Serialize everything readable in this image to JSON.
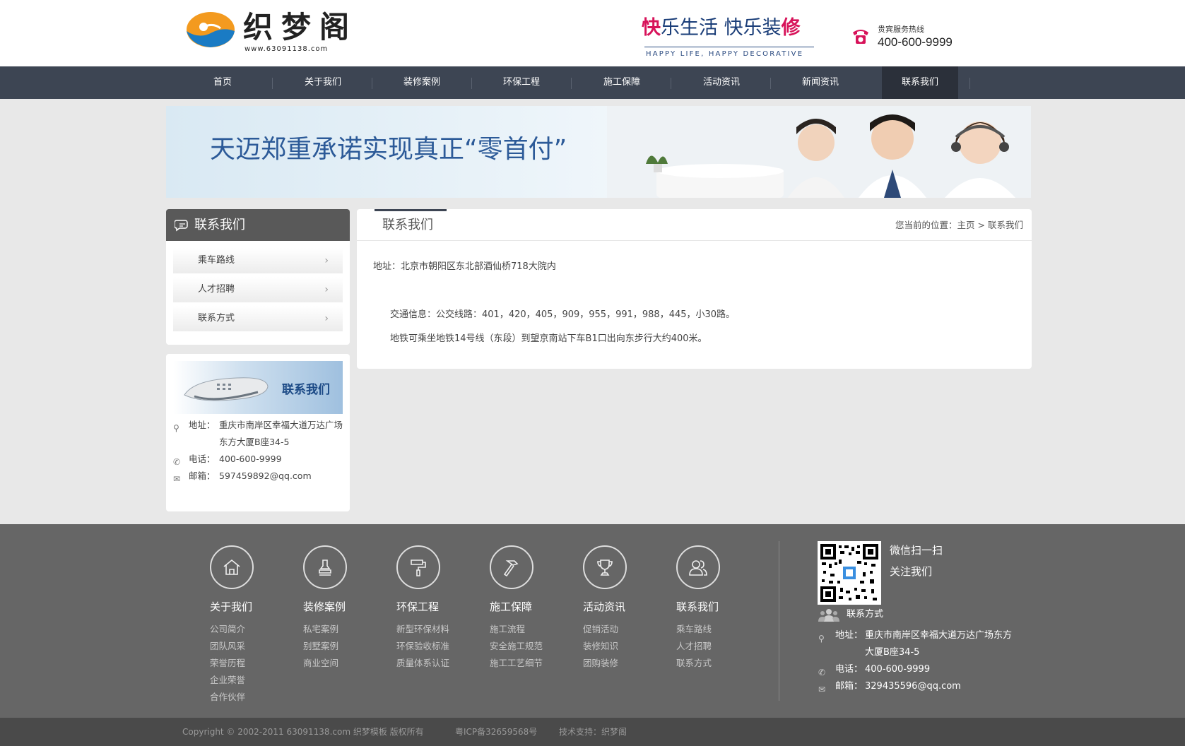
{
  "header": {
    "logo_text": "织梦阁",
    "logo_url": "www.63091138.com",
    "slogan_part1": "快",
    "slogan_part2": "乐生活 快乐装",
    "slogan_part3": "修",
    "slogan_en": "HAPPY LIFE, HAPPY DECORATIVE",
    "hotline_label": "贵宾服务热线",
    "hotline_number": "400-600-9999"
  },
  "nav": {
    "items": [
      {
        "label": "首页"
      },
      {
        "label": "关于我们"
      },
      {
        "label": "装修案例"
      },
      {
        "label": "环保工程"
      },
      {
        "label": "施工保障"
      },
      {
        "label": "活动资讯"
      },
      {
        "label": "新闻资讯"
      },
      {
        "label": "联系我们"
      }
    ],
    "active_index": 7
  },
  "banner": {
    "headline": "天迈郑重承诺实现真正“零首付”"
  },
  "sidebar": {
    "title": "联系我们",
    "items": [
      {
        "label": "乘车路线"
      },
      {
        "label": "人才招聘"
      },
      {
        "label": "联系方式"
      }
    ],
    "contact_title": "联系我们",
    "address_label": "地址：",
    "address": "重庆市南岸区幸福大道万达广场东方大厦B座34-5",
    "phone_label": "电话：",
    "phone": "400-600-9999",
    "email_label": "邮箱：",
    "email": "597459892@qq.com"
  },
  "main": {
    "title": "联系我们",
    "breadcrumb_prefix": "您当前的位置：",
    "breadcrumb_home": "主页",
    "breadcrumb_sep": ">",
    "breadcrumb_current": "联系我们",
    "address_line": "地址：北京市朝阳区东北部酒仙桥718大院内",
    "traffic_line": "交通信息：公交线路：401，420，405，909，955，991，988，445，小30路。",
    "subway_line": "地铁可乘坐地铁14号线（东段）到望京南站下车B1口出向东步行大约400米。"
  },
  "footer": {
    "columns": [
      {
        "title": "关于我们",
        "icon": "house-icon",
        "links": [
          "公司简介",
          "团队风采",
          "荣誉历程",
          "企业荣誉",
          "合作伙伴"
        ]
      },
      {
        "title": "装修案例",
        "icon": "stamp-icon",
        "links": [
          "私宅案例",
          "别墅案例",
          "商业空间"
        ]
      },
      {
        "title": "环保工程",
        "icon": "paint-roller-icon",
        "links": [
          "新型环保材料",
          "环保验收标准",
          "质量体系认证"
        ]
      },
      {
        "title": "施工保障",
        "icon": "hammer-icon",
        "links": [
          "施工流程",
          "安全施工规范",
          "施工工艺细节"
        ]
      },
      {
        "title": "活动资讯",
        "icon": "trophy-icon",
        "links": [
          "促销活动",
          "装修知识",
          "团购装修"
        ]
      },
      {
        "title": "联系我们",
        "icon": "users-icon",
        "links": [
          "乘车路线",
          "人才招聘",
          "联系方式"
        ]
      }
    ],
    "qr_line1": "微信扫一扫",
    "qr_line2": "关注我们",
    "contact_heading": "联系方式",
    "address_label": "地址：",
    "address": "重庆市南岸区幸福大道万达广场东方大厦B座34-5",
    "phone_label": "电话：",
    "phone": "400-600-9999",
    "email_label": "邮箱：",
    "email": "329435596@qq.com"
  },
  "copyright": {
    "text": "Copyright © 2002-2011 63091138.com 织梦模板 版权所有",
    "icp": "粤ICP备32659568号",
    "support": "技术支持：织梦阁"
  },
  "colors": {
    "nav_bg": "#3d4553",
    "nav_active_bg": "#2b303a",
    "footer_bg": "#666666",
    "copyright_bg": "#4a4a4a",
    "banner_text": "#2c5a98",
    "slogan_red": "#d7135a"
  }
}
